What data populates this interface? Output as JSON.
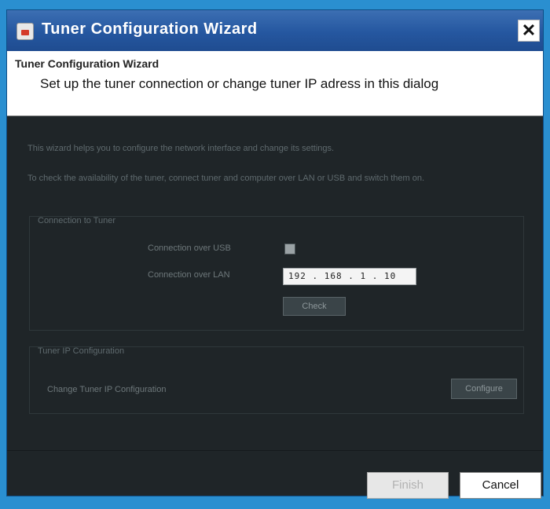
{
  "window": {
    "title": "Tuner Configuration Wizard",
    "close_glyph": "✕",
    "app_icon": "app-icon"
  },
  "header": {
    "title": "Tuner Configuration Wizard",
    "subtitle": "Set up the tuner connection or change tuner IP adress in this dialog"
  },
  "intro": {
    "line1": "This wizard helps you to configure the network interface and change its settings.",
    "line2": "To check the availability of the tuner, connect tuner and computer over LAN or USB and switch them on."
  },
  "connection_group": {
    "title": "Connection to Tuner",
    "usb_label": "Connection over USB",
    "usb_checked": false,
    "lan_label": "Connection over LAN",
    "lan_ip": "192 . 168 .  1  . 10",
    "check_button": "Check"
  },
  "ip_group": {
    "title": "Tuner IP Configuration",
    "change_label": "Change Tuner IP Configuration",
    "configure_button": "Configure"
  },
  "footer": {
    "finish_button": "Finish",
    "cancel_button": "Cancel"
  },
  "colors": {
    "titlebar": "#2557a0",
    "body_bg": "#1f2528",
    "border_accent": "#2a8fd0"
  }
}
